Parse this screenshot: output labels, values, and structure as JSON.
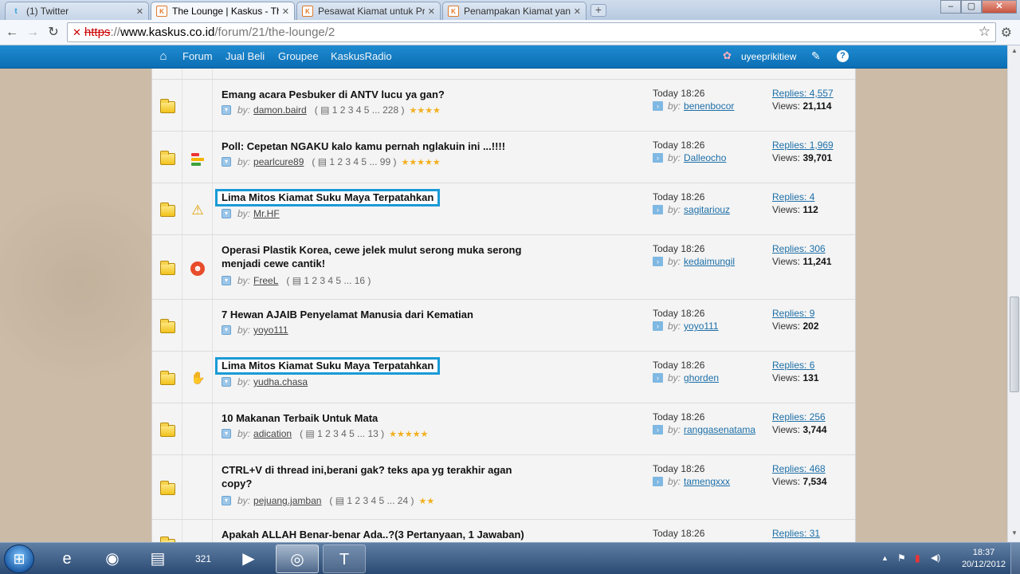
{
  "browser": {
    "tabs": [
      {
        "label": "(1) Twitter",
        "icon": "twitter-bird-icon",
        "favicon_text": "t"
      },
      {
        "label": "The Lounge | Kaskus - Th...",
        "icon": "kaskus-favicon-icon",
        "favicon_text": "K"
      },
      {
        "label": "Pesawat Kiamat untuk Pr...",
        "icon": "kaskus-favicon-icon",
        "favicon_text": "K"
      },
      {
        "label": "Penampakan Kiamat yan...",
        "icon": "kaskus-favicon-icon",
        "favicon_text": "K"
      }
    ],
    "tab_close": "✕",
    "new_tab": "+",
    "window_controls": {
      "minimize": "‒",
      "maximize": "▢",
      "close": "✕"
    },
    "nav": {
      "back": "←",
      "forward": "→",
      "reload": "↻"
    },
    "address": {
      "scheme": "https",
      "separator": "://",
      "host": "www.kaskus.co.id",
      "path": "/forum/21/the-lounge/2",
      "insecure_mark": "✕"
    },
    "bookmark_star": "☆",
    "settings_wrench": "⚙"
  },
  "site_nav": {
    "home_icon": "⌂",
    "items": [
      "Forum",
      "Jual Beli",
      "Groupee",
      "KaskusRadio"
    ],
    "user_icon": "✿",
    "username": "uyeeprikitiew",
    "edit_icon": "✎",
    "help_icon": "?"
  },
  "labels": {
    "by": "by:",
    "last_by": "by:",
    "replies_prefix": "Replies: ",
    "views_prefix": "Views: ",
    "dropdown_glyph": "▾",
    "last_post_glyph": "›",
    "pages_glyph": "▤"
  },
  "threads": [
    {
      "title": "Emang acara Pesbuker di ANTV lucu ya gan?",
      "title_line2": "",
      "highlighted": false,
      "thread_icon": "none",
      "author": "damon.baird",
      "pages": "( ▤ 1 2 3 4 5 ... 228 )",
      "stars": "★★★★",
      "last_post_time": "Today 18:26",
      "last_post_user": "benenbocor",
      "replies": "4,557",
      "views": "21,114"
    },
    {
      "title": "Poll: Cepetan NGAKU kalo kamu pernah nglakuin ini ...!!!!",
      "title_line2": "",
      "highlighted": false,
      "thread_icon": "poll-icon",
      "author": "pearlcure89",
      "pages": "( ▤ 1 2 3 4 5 ... 99 )",
      "stars": "★★★★★",
      "last_post_time": "Today 18:26",
      "last_post_user": "Dalleocho",
      "replies": "1,969",
      "views": "39,701"
    },
    {
      "title": "Lima Mitos Kiamat Suku Maya Terpatahkan",
      "title_line2": "",
      "highlighted": true,
      "thread_icon": "warning-icon",
      "thread_icon_glyph": "⚠",
      "author": "Mr.HF",
      "pages": "",
      "stars": "",
      "last_post_time": "Today 18:26",
      "last_post_user": "sagitariouz",
      "replies": "4",
      "views": "112"
    },
    {
      "title": "Operasi Plastik Korea, cewe jelek mulut serong muka serong",
      "title_line2": "menjadi cewe cantik!",
      "highlighted": false,
      "thread_icon": "laughing-face-icon",
      "thread_icon_glyph": "☻",
      "author": "FreeL",
      "pages": "( ▤ 1 2 3 4 5 ... 16 )",
      "stars": "",
      "last_post_time": "Today 18:26",
      "last_post_user": "kedaimungil",
      "replies": "306",
      "views": "11,241"
    },
    {
      "title": "7 Hewan AJAIB Penyelamat Manusia dari Kematian",
      "title_line2": "",
      "highlighted": false,
      "thread_icon": "none",
      "author": "yoyo111",
      "pages": "",
      "stars": "",
      "last_post_time": "Today 18:26",
      "last_post_user": "yoyo111",
      "replies": "9",
      "views": "202"
    },
    {
      "title": "Lima Mitos Kiamat Suku Maya Terpatahkan",
      "title_line2": "",
      "highlighted": true,
      "thread_icon": "clapping-hand-icon",
      "thread_icon_glyph": "✋",
      "author": "yudha.chasa",
      "pages": "",
      "stars": "",
      "last_post_time": "Today 18:26",
      "last_post_user": "ghorden",
      "replies": "6",
      "views": "131"
    },
    {
      "title": "10 Makanan Terbaik Untuk Mata",
      "title_line2": "",
      "highlighted": false,
      "thread_icon": "none",
      "author": "adication",
      "pages": "( ▤ 1 2 3 4 5 ... 13 )",
      "stars": "★★★★★",
      "last_post_time": "Today 18:26",
      "last_post_user": "ranggasenatama",
      "replies": "256",
      "views": "3,744"
    },
    {
      "title": "CTRL+V di thread ini,berani gak? teks apa yg terakhir agan",
      "title_line2": "copy?",
      "highlighted": false,
      "thread_icon": "none",
      "author": "pejuang.jamban",
      "pages": "( ▤ 1 2 3 4 5 ... 24 )",
      "stars": "★★",
      "last_post_time": "Today 18:26",
      "last_post_user": "tamengxxx",
      "replies": "468",
      "views": "7,534"
    },
    {
      "title": "Apakah ALLAH Benar-benar Ada..?(3 Pertanyaan, 1 Jawaban)",
      "title_line2": "",
      "highlighted": false,
      "thread_icon": "none",
      "author": "",
      "pages": "",
      "stars": "",
      "last_post_time": "Today 18:26",
      "last_post_user": "",
      "replies": "31",
      "views": ""
    }
  ],
  "taskbar": {
    "start_glyph": "⊞",
    "apps": [
      {
        "name": "internet-explorer-icon",
        "glyph": "e",
        "state": "pinned"
      },
      {
        "name": "firefox-icon",
        "glyph": "◉",
        "state": "pinned"
      },
      {
        "name": "windows-explorer-icon",
        "glyph": "▤",
        "state": "pinned"
      },
      {
        "name": "media-player-classic-icon",
        "glyph": "321",
        "state": "pinned"
      },
      {
        "name": "media-icon",
        "glyph": "▶",
        "state": "pinned"
      },
      {
        "name": "chrome-icon",
        "glyph": "◎",
        "state": "active"
      },
      {
        "name": "app-icon",
        "glyph": "T",
        "state": "open"
      }
    ],
    "tray_icons": [
      "▲",
      "⚑",
      "▮",
      "◀)"
    ],
    "time": "18:37",
    "date": "20/12/2012"
  },
  "colors": {
    "kaskus_blue": "#0c6fb5",
    "highlight_border": "#1a9ad6",
    "link": "#1d6fa8"
  }
}
